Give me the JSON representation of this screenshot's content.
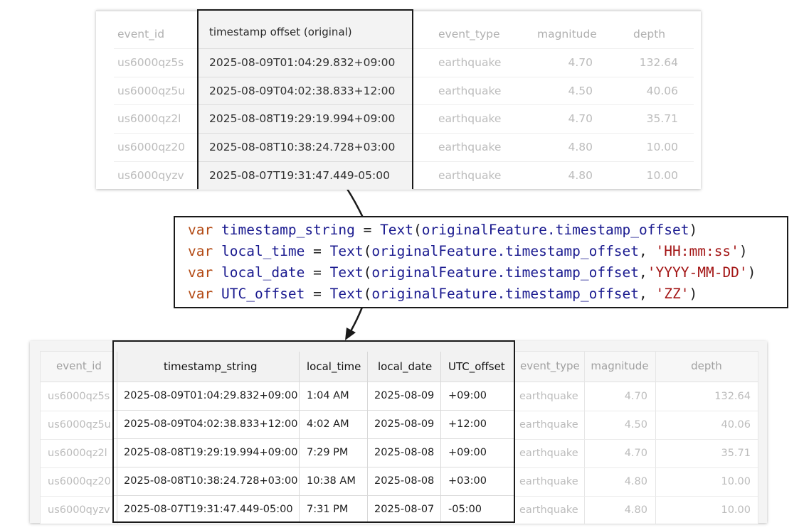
{
  "top_table": {
    "columns": [
      "event_id",
      "timestamp offset (original)",
      "event_type",
      "magnitude",
      "depth"
    ],
    "rows": [
      [
        "us6000qz5s",
        "2025-08-09T01:04:29.832+09:00",
        "earthquake",
        "4.70",
        "132.64"
      ],
      [
        "us6000qz5u",
        "2025-08-09T04:02:38.833+12:00",
        "earthquake",
        "4.50",
        "40.06"
      ],
      [
        "us6000qz2l",
        "2025-08-08T19:29:19.994+09:00",
        "earthquake",
        "4.70",
        "35.71"
      ],
      [
        "us6000qz20",
        "2025-08-08T10:38:24.728+03:00",
        "earthquake",
        "4.80",
        "10.00"
      ],
      [
        "us6000qyzv",
        "2025-08-07T19:31:47.449-05:00",
        "earthquake",
        "4.80",
        "10.00"
      ]
    ]
  },
  "code": {
    "keyword": "var",
    "lines": [
      {
        "var": "timestamp_string",
        "op": " = ",
        "fn": "Text",
        "arg": "originalFeature.timestamp_offset",
        "sep": "",
        "fmt": "",
        "close": ")"
      },
      {
        "var": "local_time",
        "op": " = ",
        "fn": "Text",
        "arg": "originalFeature.timestamp_offset",
        "sep": ", ",
        "fmt": "'HH:mm:ss'",
        "close": ")"
      },
      {
        "var": "local_date",
        "op": " = ",
        "fn": "Text",
        "arg": "originalFeature.timestamp_offset",
        "sep": ",",
        "fmt": "'YYYY-MM-DD'",
        "close": ")"
      },
      {
        "var": "UTC_offset",
        "op": " = ",
        "fn": "Text",
        "arg": "originalFeature.timestamp_offset",
        "sep": ", ",
        "fmt": "'ZZ'",
        "close": ")"
      }
    ]
  },
  "bottom_table": {
    "columns": [
      "event_id",
      "timestamp_string",
      "local_time",
      "local_date",
      "UTC_offset",
      "event_type",
      "magnitude",
      "depth"
    ],
    "rows": [
      [
        "us6000qz5s",
        "2025-08-09T01:04:29.832+09:00",
        "1:04 AM",
        "2025-08-09",
        "+09:00",
        "earthquake",
        "4.70",
        "132.64"
      ],
      [
        "us6000qz5u",
        "2025-08-09T04:02:38.833+12:00",
        "4:02 AM",
        "2025-08-09",
        "+12:00",
        "earthquake",
        "4.50",
        "40.06"
      ],
      [
        "us6000qz2l",
        "2025-08-08T19:29:19.994+09:00",
        "7:29 PM",
        "2025-08-08",
        "+09:00",
        "earthquake",
        "4.70",
        "35.71"
      ],
      [
        "us6000qz20",
        "2025-08-08T10:38:24.728+03:00",
        "10:38 AM",
        "2025-08-08",
        "+03:00",
        "earthquake",
        "4.80",
        "10.00"
      ],
      [
        "us6000qyzv",
        "2025-08-07T19:31:47.449-05:00",
        "7:31 PM",
        "2025-08-07",
        "-05:00",
        "earthquake",
        "4.80",
        "10.00"
      ]
    ]
  },
  "colors": {
    "keyword": "#b34a14",
    "identifier": "#1a1a8f",
    "string": "#a31515",
    "highlight_border": "#1a1a1a",
    "faded_text": "#bcbcbc"
  }
}
